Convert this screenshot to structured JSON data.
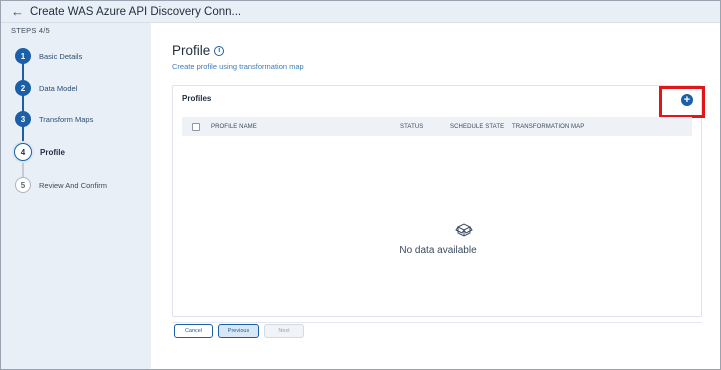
{
  "header": {
    "back_icon": "arrow-left-icon",
    "title": "Create WAS Azure API Discovery Conn..."
  },
  "sidebar": {
    "steps_label": "STEPS 4/5",
    "steps": [
      {
        "number": "1",
        "label": "Basic Details",
        "state": "done"
      },
      {
        "number": "2",
        "label": "Data Model",
        "state": "done"
      },
      {
        "number": "3",
        "label": "Transform Maps",
        "state": "done"
      },
      {
        "number": "4",
        "label": "Profile",
        "state": "current"
      },
      {
        "number": "5",
        "label": "Review And Confirm",
        "state": "pending"
      }
    ]
  },
  "main": {
    "title": "Profile",
    "info_icon": "i",
    "subtitle": "Create profile using transformation map",
    "card": {
      "title": "Profiles",
      "add_icon": "+",
      "columns": [
        "PROFILE NAME",
        "STATUS",
        "SCHEDULE STATE",
        "TRANSFORMATION MAP"
      ],
      "empty_text": "No data available"
    },
    "buttons": {
      "cancel": "Cancel",
      "previous": "Previous",
      "next": "Next"
    }
  },
  "colors": {
    "accent": "#1b5fa8",
    "sidebar_bg": "#e9eff6",
    "highlight": "#e0161b"
  }
}
